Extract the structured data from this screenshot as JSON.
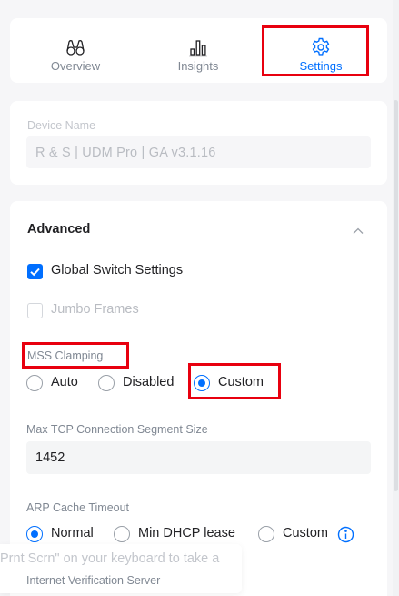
{
  "tabs": [
    {
      "label": "Overview",
      "icon": "binoculars-icon",
      "active": false
    },
    {
      "label": "Insights",
      "icon": "bar-chart-icon",
      "active": false
    },
    {
      "label": "Settings",
      "icon": "gear-icon",
      "active": true
    }
  ],
  "device": {
    "label": "Device Name",
    "value": "R & S | UDM Pro | GA v3.1.16"
  },
  "advanced": {
    "title": "Advanced",
    "global_switch": {
      "label": "Global Switch Settings",
      "checked": true
    },
    "jumbo_frames": {
      "label": "Jumbo Frames",
      "checked": false
    },
    "mss_clamping": {
      "label": "MSS Clamping",
      "options": [
        "Auto",
        "Disabled",
        "Custom"
      ],
      "selected": "Custom"
    },
    "tcp_segment": {
      "label": "Max TCP Connection Segment Size",
      "value": "1452"
    },
    "arp_cache": {
      "label": "ARP Cache Timeout",
      "options": [
        "Normal",
        "Min DHCP lease",
        "Custom"
      ],
      "selected": "Normal"
    },
    "internet_verification": {
      "label": "Internet Verification Server"
    }
  },
  "toast": {
    "text": "Prnt Scrn\" on your keyboard to take a"
  },
  "colors": {
    "accent": "#006fff",
    "highlight": "#e8000f",
    "background": "#f6f6f8"
  }
}
